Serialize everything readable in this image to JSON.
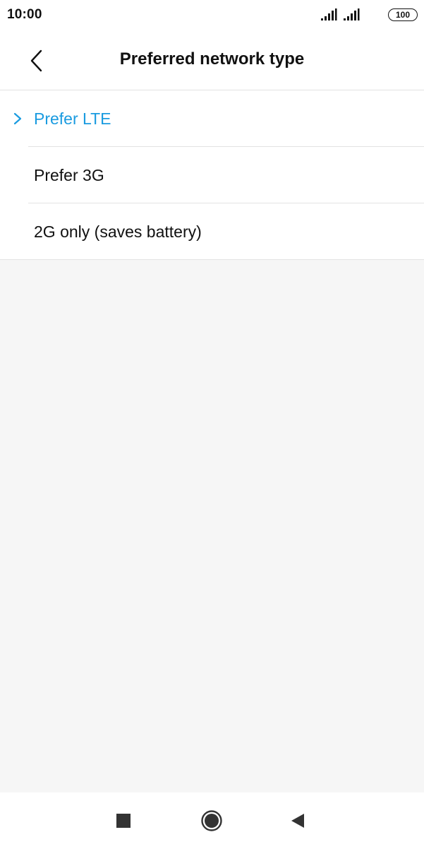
{
  "status_bar": {
    "time": "10:00",
    "battery_level": "100",
    "icons": [
      "signal-sim1-icon",
      "signal-sim2-icon",
      "battery-icon"
    ]
  },
  "header": {
    "title": "Preferred network type",
    "back_icon": "chevron-left-icon"
  },
  "options": {
    "items": [
      {
        "label": "Prefer LTE",
        "selected": true
      },
      {
        "label": "Prefer 3G",
        "selected": false
      },
      {
        "label": "2G only (saves battery)",
        "selected": false
      }
    ]
  },
  "nav_bar": {
    "icons": [
      "square-recents-icon",
      "circle-home-icon",
      "triangle-back-icon"
    ]
  },
  "colors": {
    "accent": "#1a9be0",
    "text": "#111111",
    "background": "#f6f6f6",
    "surface": "#ffffff",
    "divider": "#e3e3e3",
    "nav_icon": "#333333"
  }
}
